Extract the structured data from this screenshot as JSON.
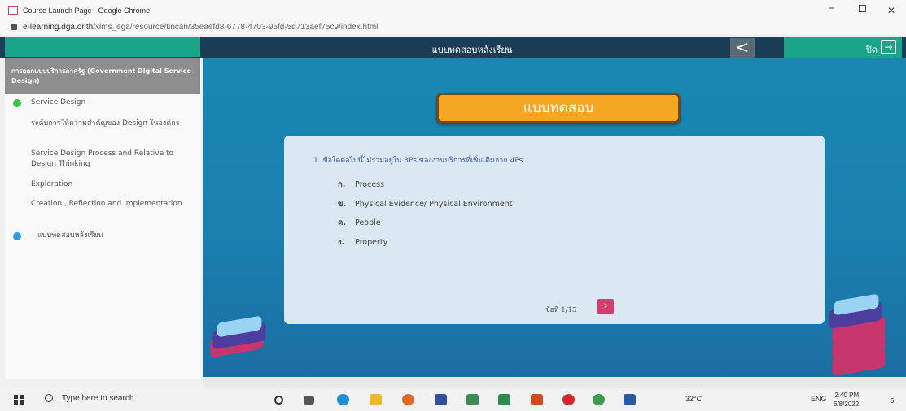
{
  "window": {
    "title": "Course Launch Page - Google Chrome",
    "min_glyph": "–",
    "close_glyph": "✕"
  },
  "address": {
    "host": "e-learning.dga.or.th",
    "path": "/xlms_ega/resource/tincan/35eaefd8-6778-4703-95fd-5d713aef75c9/index.html"
  },
  "header": {
    "title": "แบบทดสอบหลังเรียน",
    "back_glyph": "<",
    "exit_label": "ปิด",
    "exit_glyph": "→"
  },
  "sidebar": {
    "course_title": "การออกแบบบริการภาครัฐ (Government Digital Service Design)",
    "items": [
      {
        "label": "Service Design",
        "status_color": "#3bc14a"
      },
      {
        "label": "ระดับการให้ความสำคัญของ Design ในองค์กร"
      },
      {
        "label": "Service Design Process and Relative to Design Thinking"
      },
      {
        "label": "Exploration"
      },
      {
        "label": "Creation , Reflection and Implementation"
      },
      {
        "label": "แบบทดสอบหลังเรียน",
        "status_color": "#2f9ce0"
      }
    ]
  },
  "quiz": {
    "banner": "แบบทดสอบ",
    "question": "1. ข้อใดต่อไปนี้ไม่รวมอยู่ใน 3Ps ของงานบริการที่เพิ่มเติมจาก 4Ps",
    "options": [
      {
        "key": "ก.",
        "text": "Process"
      },
      {
        "key": "ข.",
        "text": "Physical Evidence/ Physical Environment"
      },
      {
        "key": "ค.",
        "text": "People"
      },
      {
        "key": "ง.",
        "text": "Property"
      }
    ],
    "counter": "ข้อที่ 1/15",
    "next_glyph": "›"
  },
  "taskbar": {
    "search_placeholder": "Type here to search",
    "weather": "32°C",
    "language": "ENG",
    "time": "2:40 PM",
    "date": "6/8/2022",
    "notification_count": "5"
  },
  "colors": {
    "header_bg": "#1b3d55",
    "accent_green": "#1aa48a",
    "stage_blue": "#1a87b3",
    "banner_orange": "#f5a623",
    "next_pink": "#d63c6c"
  }
}
